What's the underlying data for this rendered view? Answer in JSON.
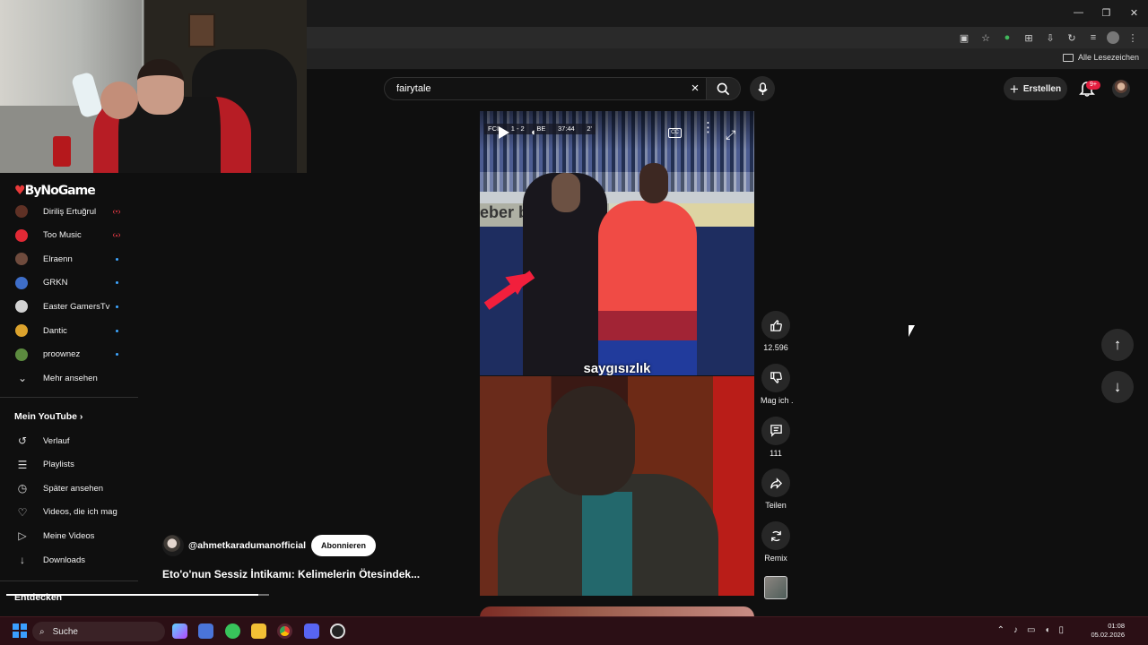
{
  "browser": {
    "bookmarks_label": "Alle Lesezeichen",
    "window_controls": [
      "—",
      "❐",
      "✕"
    ],
    "toolbar_icons": [
      "screen-share-icon",
      "star-icon",
      "extension-icon",
      "puzzle-icon",
      "download-icon",
      "history-icon",
      "media-icon",
      "profile-icon",
      "more-icon"
    ]
  },
  "youtube": {
    "search": {
      "value": "fairytale",
      "clear_icon": "×"
    },
    "create_label": "Erstellen",
    "notification_count": "9+"
  },
  "sidebar": {
    "brand": "ByNoGame",
    "subscriptions": [
      {
        "label": "Diriliş Ertuğrul",
        "status": "live",
        "avatar_color": "#5f3125"
      },
      {
        "label": "Too Music",
        "status": "live",
        "avatar_color": "#e12935"
      },
      {
        "label": "Elraenn",
        "status": "new",
        "avatar_color": "#6f4b3d"
      },
      {
        "label": "GRKN",
        "status": "new",
        "avatar_color": "#3e6ec9"
      },
      {
        "label": "Easter GamersTv",
        "status": "new",
        "avatar_color": "#d2d2d2"
      },
      {
        "label": "Dantic",
        "status": "new",
        "avatar_color": "#dca32d"
      },
      {
        "label": "proownez",
        "status": "new",
        "avatar_color": "#5c8b3f"
      }
    ],
    "more_label": "Mehr ansehen",
    "my_youtube": "Mein YouTube",
    "library_items": [
      {
        "label": "Verlauf",
        "icon": "history-icon"
      },
      {
        "label": "Playlists",
        "icon": "playlist-icon"
      },
      {
        "label": "Später ansehen",
        "icon": "clock-icon"
      },
      {
        "label": "Videos, die ich mag",
        "icon": "thumb-up-icon"
      },
      {
        "label": "Meine Videos",
        "icon": "video-icon"
      },
      {
        "label": "Downloads",
        "icon": "download-icon"
      }
    ],
    "discover": "Entdecken"
  },
  "short": {
    "scoreboard": {
      "team": "FCI",
      "score": "1 - 2",
      "opponent": "BE",
      "time": "37:44",
      "extra": "2'"
    },
    "overlay_text": "saygısızlık",
    "billboard_text": "eber  ber  Viatel",
    "progress": 0.96,
    "channel": "@ahmetkaradumanofficial",
    "subscribe": "Abonnieren",
    "title": "Eto'o'nun Sessiz İntikamı: Kelimelerin Ötesindek..."
  },
  "actions": [
    {
      "icon": "thumb-up-icon",
      "label": "12.596"
    },
    {
      "icon": "thumb-down-icon",
      "label": "Mag ich ."
    },
    {
      "icon": "comment-icon",
      "label": "111"
    },
    {
      "icon": "share-icon",
      "label": "Teilen"
    },
    {
      "icon": "remix-icon",
      "label": "Remix"
    }
  ],
  "taskbar": {
    "search_label": "Suche",
    "time": "01:08",
    "date": "05.02.2026"
  }
}
